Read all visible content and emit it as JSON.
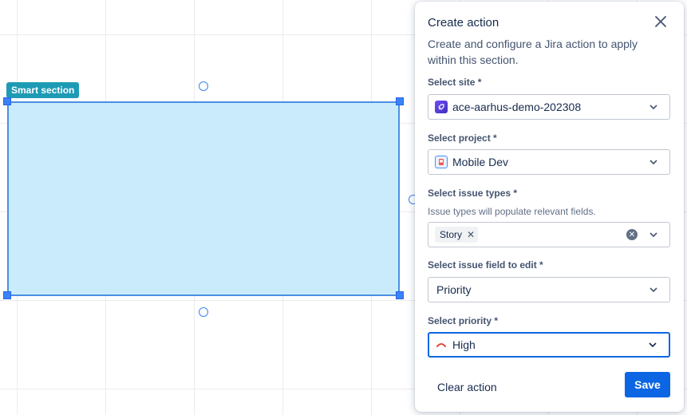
{
  "canvas": {
    "section_tag": "Smart section"
  },
  "panel": {
    "title": "Create action",
    "description": "Create and configure a Jira action to apply within this section.",
    "site": {
      "label": "Select site *",
      "value": "ace-aarhus-demo-202308",
      "icon": "site-rocket-icon"
    },
    "project": {
      "label": "Select project *",
      "value": "Mobile Dev",
      "icon": "project-icon"
    },
    "issue_types": {
      "label": "Select issue types *",
      "help": "Issue types will populate relevant fields.",
      "selected": [
        "Story"
      ]
    },
    "issue_field": {
      "label": "Select issue field to edit *",
      "value": "Priority"
    },
    "priority": {
      "label": "Select priority *",
      "value": "High",
      "icon": "priority-high-icon",
      "icon_color": "#e2483d"
    },
    "clear_label": "Clear action",
    "save_label": "Save"
  },
  "colors": {
    "accent": "#0c66e4",
    "section_fill": "#c9ebfb",
    "section_tag": "#1d9bb5"
  }
}
